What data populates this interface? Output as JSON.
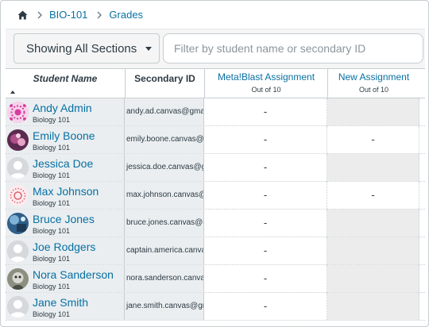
{
  "breadcrumb": {
    "home_icon": "home-icon",
    "course": "BIO-101",
    "page": "Grades"
  },
  "toolbar": {
    "section_label": "Showing All Sections",
    "filter_placeholder": "Filter by student name or secondary ID"
  },
  "columns": {
    "student": "Student Name",
    "secondary": "Secondary ID",
    "assignments": [
      {
        "name": "Meta!Blast Assignment",
        "out_of": "Out of 10"
      },
      {
        "name": "New Assignment",
        "out_of": "Out of 10"
      }
    ]
  },
  "students": [
    {
      "name": "Andy Admin",
      "section": "Biology 101",
      "secondary_id": "andy.ad.canvas@gmail.com",
      "grades": [
        "-",
        ""
      ],
      "avatar": "pattern-pink"
    },
    {
      "name": "Emily Boone",
      "section": "Biology 101",
      "secondary_id": "emily.boone.canvas@gmail.com",
      "grades": [
        "-",
        "-"
      ],
      "avatar": "photo-purple"
    },
    {
      "name": "Jessica Doe",
      "section": "Biology 101",
      "secondary_id": "jessica.doe.canvas@gmail.com",
      "grades": [
        "-",
        ""
      ],
      "avatar": "default"
    },
    {
      "name": "Max Johnson",
      "section": "Biology 101",
      "secondary_id": "max.johnson.canvas@gmail.com",
      "grades": [
        "-",
        "-"
      ],
      "avatar": "pattern-red"
    },
    {
      "name": "Bruce Jones",
      "section": "Biology 101",
      "secondary_id": "bruce.jones.canvas@gmail.com",
      "grades": [
        "-",
        ""
      ],
      "avatar": "photo-blue"
    },
    {
      "name": "Joe Rodgers",
      "section": "Biology 101",
      "secondary_id": "captain.america.canvas@gmail.com",
      "grades": [
        "-",
        ""
      ],
      "avatar": "default"
    },
    {
      "name": "Nora Sanderson",
      "section": "Biology 101",
      "secondary_id": "nora.sanderson.canvas@gmail.com",
      "grades": [
        "-",
        ""
      ],
      "avatar": "photo-grey"
    },
    {
      "name": "Jane Smith",
      "section": "Biology 101",
      "secondary_id": "jane.smith.canvas@gmail.com",
      "grades": [
        "-",
        ""
      ],
      "avatar": "default"
    }
  ],
  "colors": {
    "link": "#0770a3",
    "student_cell_bg": "#eaeef0",
    "empty_grade_bg": "#ececec"
  }
}
